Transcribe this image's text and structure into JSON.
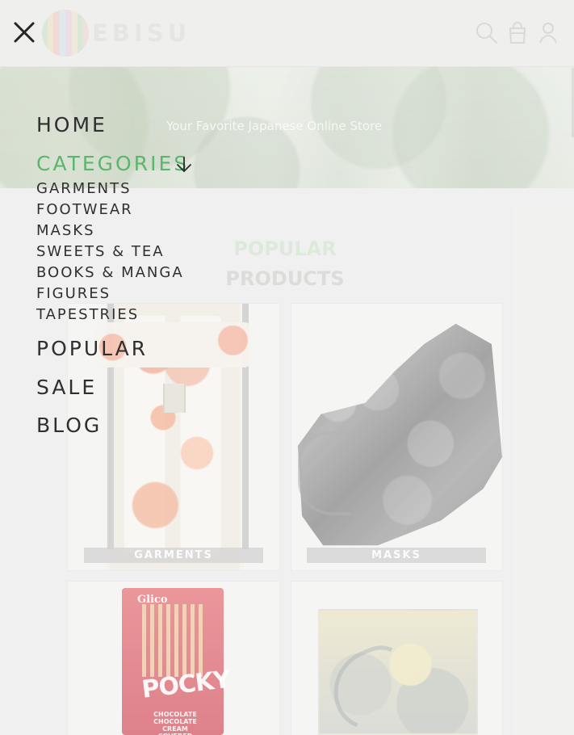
{
  "header": {
    "brand": "EBISU"
  },
  "hero": {
    "tagline": "Your Favorite Japanese Online Store"
  },
  "menu": {
    "main": [
      "HOME",
      "CATEGORIES",
      "POPULAR",
      "SALE",
      "BLOG"
    ],
    "categories": [
      "GARMENTS",
      "FOOTWEAR",
      "MASKS",
      "SWEETS & TEA",
      "BOOKS & MANGA",
      "FIGURES",
      "TAPESTRIES"
    ]
  },
  "section": {
    "title_line_1": "POPULAR",
    "title_line_2": "PRODUCTS"
  },
  "cards": {
    "garments_label": "GARMENTS",
    "masks_label": "MASKS",
    "pocky_brand": "Glico",
    "pocky_name": "POCKY",
    "pocky_sub": "CHOCOLATE CHOCOLATE CREAM COVERED"
  },
  "colors": {
    "accent": "#5ab66d",
    "text": "#2f2f2f",
    "background": "#f0f0ef"
  },
  "icons": {
    "close": "close-icon",
    "search": "search-icon",
    "bag": "shopping-bag-icon",
    "user": "user-icon",
    "chevron": "arrow-down-icon"
  }
}
